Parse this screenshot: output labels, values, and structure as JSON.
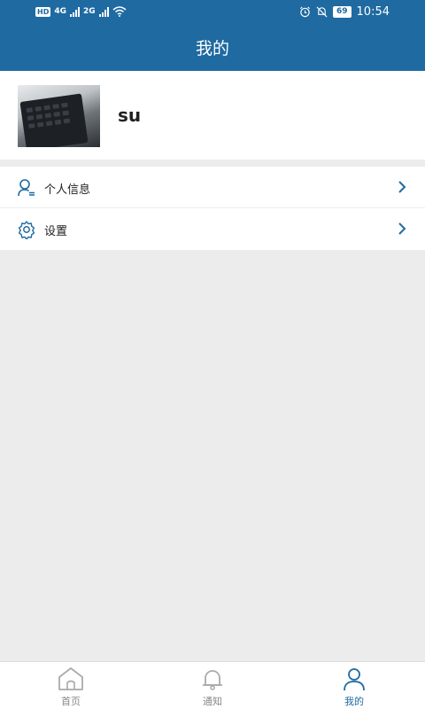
{
  "status_bar": {
    "network": "HD",
    "signal1": "4G",
    "signal2": "2G",
    "battery": "69",
    "time": "10:54"
  },
  "header": {
    "title": "我的"
  },
  "profile": {
    "username": "su"
  },
  "menu": {
    "items": [
      {
        "icon": "user-info-icon",
        "label": "个人信息"
      },
      {
        "icon": "gear-icon",
        "label": "设置"
      }
    ]
  },
  "tabbar": {
    "tabs": [
      {
        "icon": "home-icon",
        "label": "首页"
      },
      {
        "icon": "bell-icon",
        "label": "通知"
      },
      {
        "icon": "user-icon",
        "label": "我的"
      }
    ]
  },
  "colors": {
    "primary": "#1f6aa1",
    "background": "#ececec"
  }
}
